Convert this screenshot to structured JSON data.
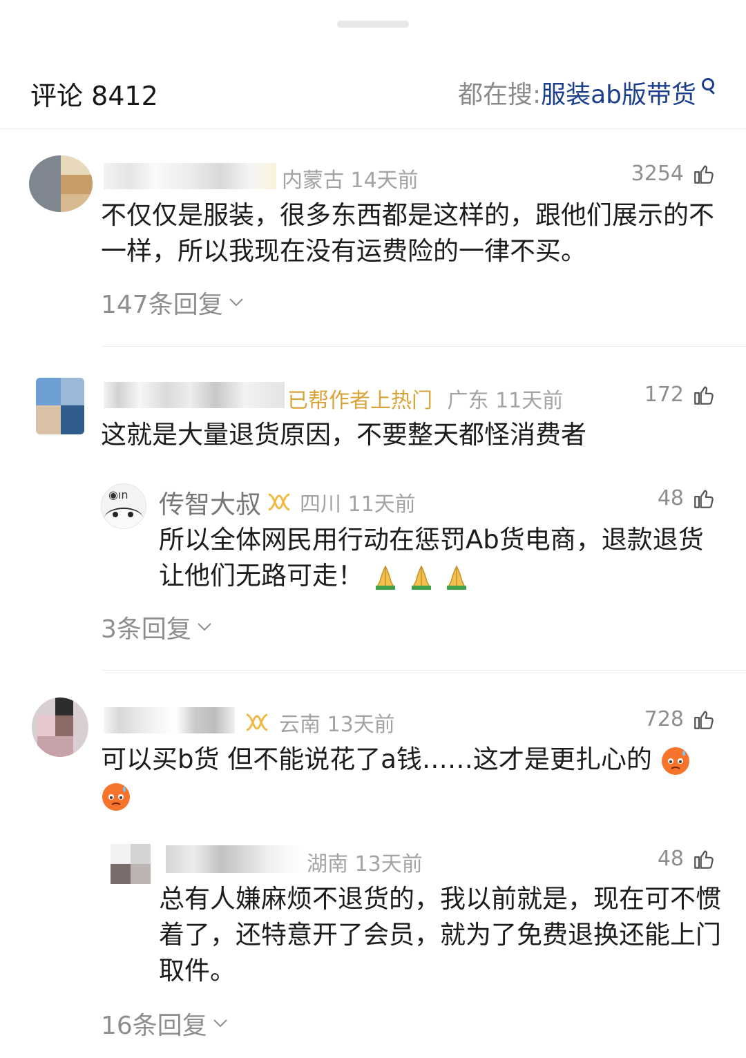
{
  "header": {
    "title": "评论 8412",
    "search_prefix": "都在搜: ",
    "search_keyword": "服装ab版带货"
  },
  "comments": [
    {
      "location_time": "内蒙古 14天前",
      "likes": "3254",
      "text": "不仅仅是服装，很多东西都是这样的，跟他们展示的不一样，所以我现在没有运费险的一律不买。",
      "replies_label": "147条回复"
    },
    {
      "tag": "已帮作者上热门",
      "location_time": "广东 11天前",
      "likes": "172",
      "text": "这就是大量退货原因，不要整天都怪消费者",
      "reply": {
        "author": "传智大叔",
        "location_time": "四川 11天前",
        "likes": "48",
        "text": "所以全体网民用行动在惩罚Ab货电商，退款退货让他们无路可走！"
      },
      "replies_label": "3条回复"
    },
    {
      "location_time": "云南 13天前",
      "likes": "728",
      "text": "可以买b货 但不能说花了a钱……这才是更扎心的",
      "reply": {
        "location_time": "湖南 13天前",
        "likes": "48",
        "text": "总有人嫌麻烦不退货的，我以前就是，现在可不惯着了，还特意开了会员，就为了免费退换还能上门取件。"
      },
      "replies_label": "16条回复"
    }
  ],
  "icons": {
    "like": "thumbs-up-icon",
    "search": "search-icon",
    "vip": "vip-badge-icon",
    "expand": "chevron-down-icon",
    "pray": "folded-hands-emoji",
    "sweat": "anxious-sweat-face-emoji"
  },
  "colors": {
    "keyword": "#1b3f8c",
    "tag": "#d8a43a",
    "vip": "#f1b842",
    "meta": "#a3a3a3"
  }
}
